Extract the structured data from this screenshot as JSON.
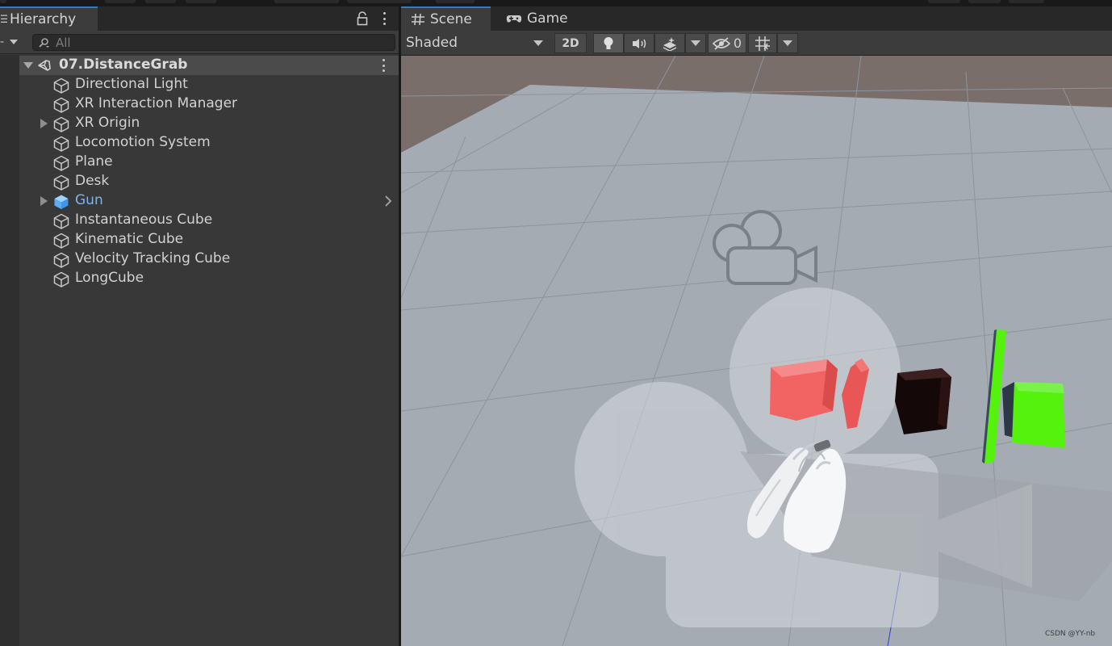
{
  "hierarchy": {
    "tab_label": "Hierarchy",
    "search_placeholder": "All",
    "scene_name": "07.DistanceGrab",
    "items": [
      {
        "label": "Directional Light",
        "expandable": false,
        "prefab": false
      },
      {
        "label": "XR Interaction Manager",
        "expandable": false,
        "prefab": false
      },
      {
        "label": "XR Origin",
        "expandable": true,
        "prefab": false
      },
      {
        "label": "Locomotion System",
        "expandable": false,
        "prefab": false
      },
      {
        "label": "Plane",
        "expandable": false,
        "prefab": false
      },
      {
        "label": "Desk",
        "expandable": false,
        "prefab": false
      },
      {
        "label": "Gun",
        "expandable": true,
        "prefab": true
      },
      {
        "label": "Instantaneous Cube",
        "expandable": false,
        "prefab": false
      },
      {
        "label": "Kinematic Cube",
        "expandable": false,
        "prefab": false
      },
      {
        "label": "Velocity Tracking Cube",
        "expandable": false,
        "prefab": false
      },
      {
        "label": "LongCube",
        "expandable": false,
        "prefab": false
      }
    ]
  },
  "scene_view": {
    "tabs": [
      {
        "label": "Scene",
        "icon": "grid-hash-icon",
        "active": true
      },
      {
        "label": "Game",
        "icon": "gamepad-icon",
        "active": false
      }
    ],
    "draw_mode": "Shaded",
    "toggle_2d": "2D",
    "hidden_count": "0",
    "watermark": "CSDN @YY-nb"
  },
  "colors": {
    "accent": "#3a79bb",
    "prefab_text": "#7bb4f2",
    "red_cube": "#f26464",
    "green_cube": "#55f20e",
    "dark_cube": "#140808"
  }
}
